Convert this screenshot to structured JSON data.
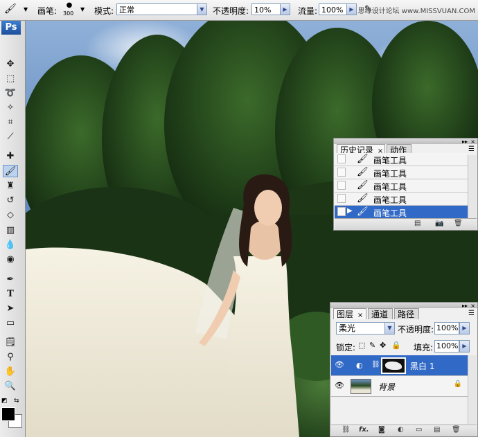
{
  "options_bar": {
    "brush_label": "画笔:",
    "brush_size": "300",
    "mode_label": "模式:",
    "mode_value": "正常",
    "opacity_label": "不透明度:",
    "opacity_value": "10%",
    "flow_label": "流量:",
    "flow_value": "100%",
    "watermark": "思缘设计论坛 www.MISSVUAN.COM"
  },
  "toolbox": {
    "logo": "Ps",
    "type_tool_glyph": "T"
  },
  "history_panel": {
    "tabs": [
      "历史记录",
      "动作"
    ],
    "close_glyph": "×",
    "items": [
      {
        "label": "画笔工具",
        "selected": false
      },
      {
        "label": "画笔工具",
        "selected": false
      },
      {
        "label": "画笔工具",
        "selected": false
      },
      {
        "label": "画笔工具",
        "selected": false
      },
      {
        "label": "画笔工具",
        "selected": true
      }
    ]
  },
  "layers_panel": {
    "tabs": [
      "图层",
      "通道",
      "路径"
    ],
    "close_glyph": "×",
    "blend_mode": "柔光",
    "opacity_label": "不透明度:",
    "opacity_value": "100%",
    "lock_label": "锁定:",
    "fill_label": "填充:",
    "fill_value": "100%",
    "layers": [
      {
        "name": "黑白 1",
        "selected": true,
        "type": "adjustment"
      },
      {
        "name": "背景",
        "selected": false,
        "type": "background",
        "locked": true
      }
    ],
    "footer_fx": "fx."
  },
  "colors": {
    "selection": "#3169c6",
    "foreground": "#000000",
    "background": "#ffffff"
  }
}
